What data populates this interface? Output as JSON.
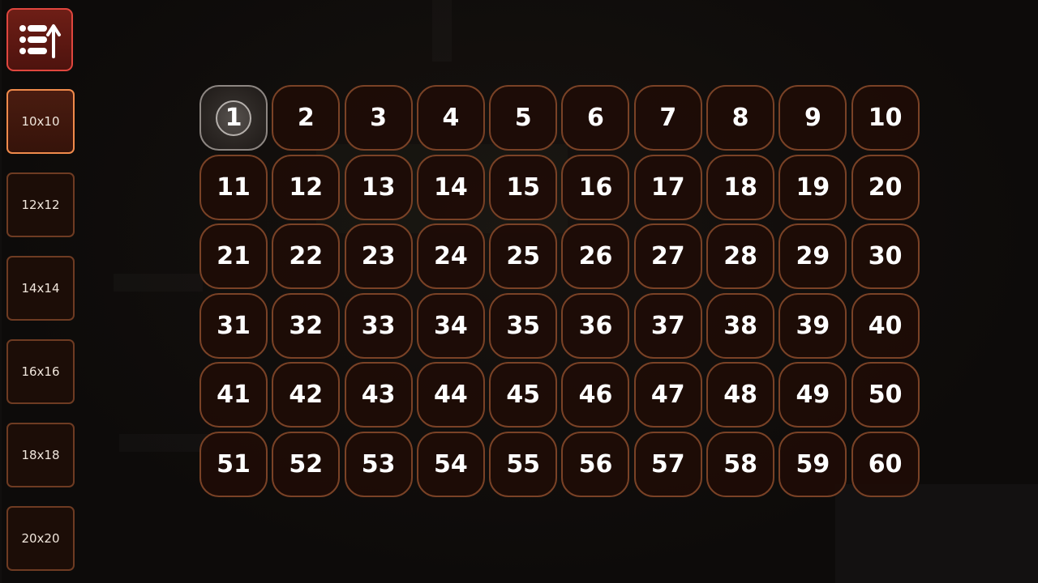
{
  "sidebar": {
    "menu_icon": "list-return-icon",
    "sizes": [
      {
        "label": "10x10",
        "active": true
      },
      {
        "label": "12x12",
        "active": false
      },
      {
        "label": "14x14",
        "active": false
      },
      {
        "label": "16x16",
        "active": false
      },
      {
        "label": "18x18",
        "active": false
      },
      {
        "label": "20x20",
        "active": false
      }
    ]
  },
  "grid": {
    "columns": 10,
    "selected": "1",
    "cells": [
      "1",
      "2",
      "3",
      "4",
      "5",
      "6",
      "7",
      "8",
      "9",
      "10",
      "11",
      "12",
      "13",
      "14",
      "15",
      "16",
      "17",
      "18",
      "19",
      "20",
      "21",
      "22",
      "23",
      "24",
      "25",
      "26",
      "27",
      "28",
      "29",
      "30",
      "31",
      "32",
      "33",
      "34",
      "35",
      "36",
      "37",
      "38",
      "39",
      "40",
      "41",
      "42",
      "43",
      "44",
      "45",
      "46",
      "47",
      "48",
      "49",
      "50",
      "51",
      "52",
      "53",
      "54",
      "55",
      "56",
      "57",
      "58",
      "59",
      "60"
    ]
  },
  "colors": {
    "accent_red": "#e0463e",
    "active_border": "#f08a4b",
    "cell_border": "#7a4226",
    "cell_fill": "#1e0c06"
  }
}
